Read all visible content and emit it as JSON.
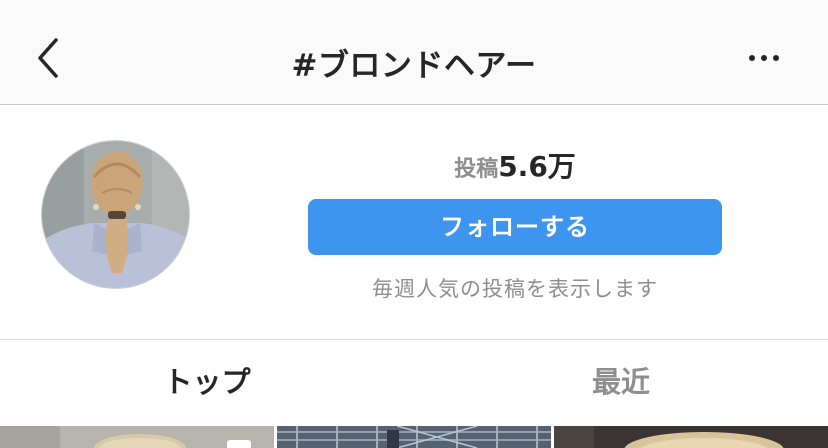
{
  "nav": {
    "title": "#ブロンドヘアー"
  },
  "header": {
    "stat_label": "投稿",
    "stat_value": "5.6万",
    "follow_label": "フォローする",
    "subtitle": "毎週人気の投稿を表示します"
  },
  "tabs": [
    {
      "label": "トップ",
      "active": true
    },
    {
      "label": "最近",
      "active": false
    }
  ],
  "colors": {
    "accent": "#3e95f0",
    "text_primary": "#262626",
    "text_secondary": "#8e8e8e",
    "nav_background": "#fafafa"
  },
  "icons": {
    "back": "chevron-left-icon",
    "more": "more-horizontal-icon",
    "carousel": "multiple-posts-icon"
  }
}
